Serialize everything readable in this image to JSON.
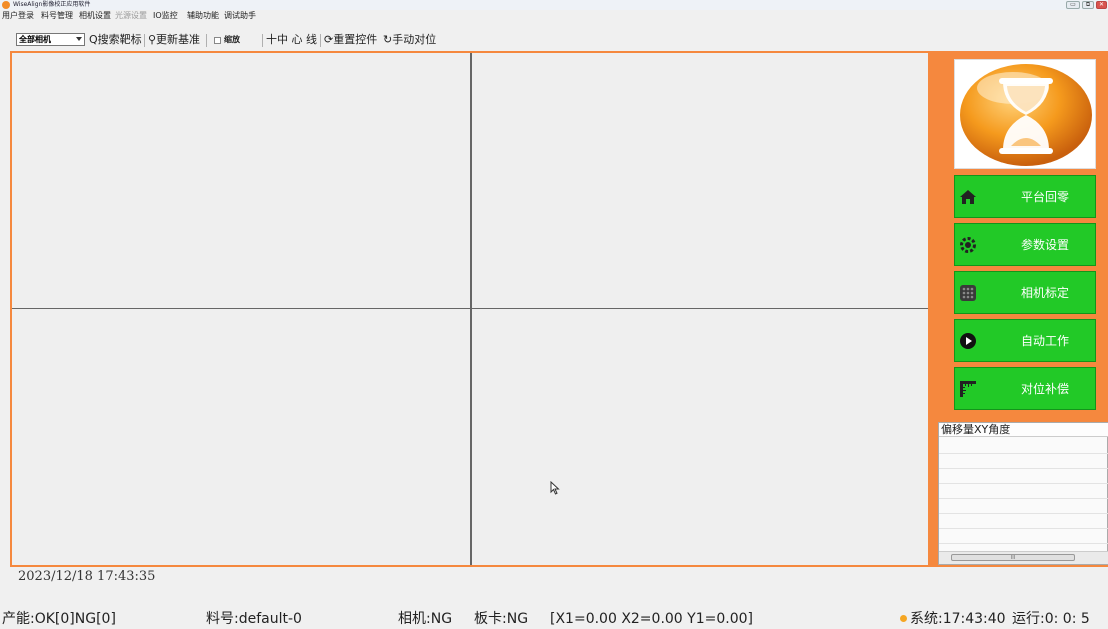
{
  "window": {
    "title": "WiseAlign影像校正应用软件",
    "min_label": "▭",
    "restore_label": "⧉",
    "close_label": "✕"
  },
  "menu": [
    {
      "label": "用户登录",
      "disabled": false
    },
    {
      "label": "料号管理",
      "disabled": false
    },
    {
      "label": "相机设置",
      "disabled": false
    },
    {
      "label": "光源设置",
      "disabled": true
    },
    {
      "label": "IO监控",
      "disabled": false
    },
    {
      "label": "辅助功能",
      "disabled": false
    },
    {
      "label": "调试助手",
      "disabled": false
    }
  ],
  "toolbar": {
    "camera_select": "全部相机",
    "search_target": "Q搜索靶标",
    "update_reference": "⚲更新基准",
    "zoom": "缩放",
    "crosshair": "十中 心 线",
    "reset_controls": "⟳重置控件",
    "manual_align": "↻手动对位"
  },
  "side_buttons": [
    {
      "label": "平台回零",
      "icon": "home-icon"
    },
    {
      "label": "参数设置",
      "icon": "gear-icon"
    },
    {
      "label": "相机标定",
      "icon": "calibration-grid-icon"
    },
    {
      "label": "自动工作",
      "icon": "play-icon"
    },
    {
      "label": "对位补偿",
      "icon": "ruler-icon"
    }
  ],
  "offset_panel": {
    "title": "偏移量XY角度",
    "scroll_label": "III"
  },
  "log": {
    "timestamp": "2023/12/18 17:43:35"
  },
  "status": {
    "yield": "产能:OK[0]NG[0]",
    "part_no": "料号:default-0",
    "camera": "相机:NG",
    "board": "板卡:NG",
    "coords": "[X1=0.00 X2=0.00 Y1=0.00]",
    "system_time": "系统:17:43:40",
    "runtime": "运行:0: 0: 5"
  },
  "colors": {
    "accent": "#f5883e",
    "button_green": "#22c927",
    "pane_bg": "#efefef"
  }
}
